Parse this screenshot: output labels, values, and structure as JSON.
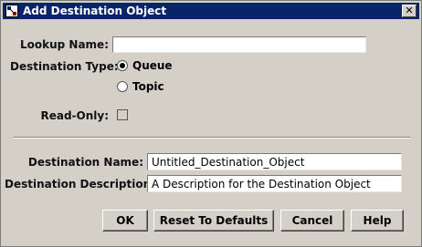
{
  "window": {
    "title": "Add Destination Object",
    "close_symbol": "✕"
  },
  "form": {
    "lookup_name_label": "Lookup Name:",
    "lookup_name_value": "",
    "destination_type_label": "Destination Type:",
    "type_options": [
      {
        "label": "Queue",
        "selected": true
      },
      {
        "label": "Topic",
        "selected": false
      }
    ],
    "read_only_label": "Read-Only:",
    "read_only_checked": false,
    "destination_name_label": "Destination Name:",
    "destination_name_value": "Untitled_Destination_Object",
    "destination_description_label": "Destination Description:",
    "destination_description_value": "A Description for the Destination Object"
  },
  "buttons": {
    "ok": "OK",
    "reset": "Reset To Defaults",
    "cancel": "Cancel",
    "help": "Help"
  }
}
